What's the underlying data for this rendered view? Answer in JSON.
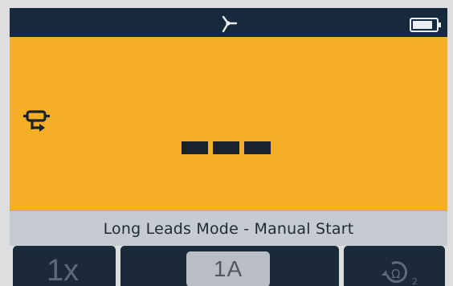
{
  "status_bar": {
    "probe_icon": "probe-icon",
    "battery_icon": "battery-icon"
  },
  "reading": {
    "leads_icon": "long-leads-icon",
    "value": "---"
  },
  "mode": {
    "title": "Long Leads Mode - Manual Start"
  },
  "softkeys": {
    "multiplier": "1x",
    "current": "1A",
    "null_icon": "null-ohm-icon",
    "null_subscript": "2"
  },
  "colors": {
    "status_bar": "#17293d",
    "reading_panel": "#f5ae26",
    "mode_bar": "#c5cbd1",
    "softkey": "#1b2a3a",
    "chip": "#b9bec4"
  }
}
